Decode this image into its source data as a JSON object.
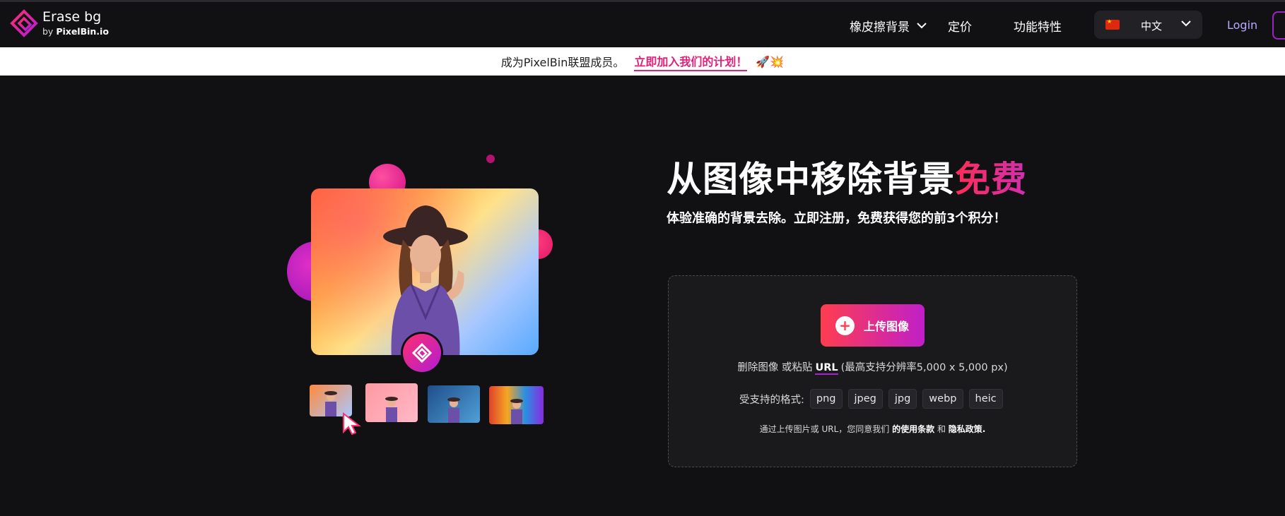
{
  "brand": {
    "title": "Erase bg",
    "sub_prefix": "by ",
    "sub_name": "PixelBin.io"
  },
  "nav": {
    "items": [
      {
        "label": "橡皮擦背景",
        "has_dropdown": true
      },
      {
        "label": "定价",
        "has_dropdown": false
      },
      {
        "label": "功能特性",
        "has_dropdown": false
      }
    ],
    "language": "中文",
    "login": "Login"
  },
  "banner": {
    "text": "成为PixelBin联盟成员。",
    "link": "立即加入我们的计划！",
    "emoji": "🚀💥"
  },
  "hero": {
    "title_main": "从图像中移除背景",
    "title_accent": "免费",
    "subtitle": "体验准确的背景去除。立即注册，免费获得您的前3个积分！"
  },
  "upload": {
    "button": "上传图像",
    "paste_prefix": "删除图像 或粘贴",
    "url_label": "URL",
    "paste_suffix": "(最高支持分辨率5,000 x 5,000 px)",
    "formats_label": "受支持的格式:",
    "formats": [
      "png",
      "jpeg",
      "jpg",
      "webp",
      "heic"
    ],
    "terms_prefix": "通过上传图片或 URL，您同意我们",
    "terms_link": "的使用条款",
    "terms_and": "和",
    "privacy_link": "隐私政策."
  },
  "colors": {
    "accent_pink": "#e0217a",
    "gradient_start": "#ff3d4f",
    "gradient_end": "#c01fc9",
    "bg": "#111114"
  }
}
